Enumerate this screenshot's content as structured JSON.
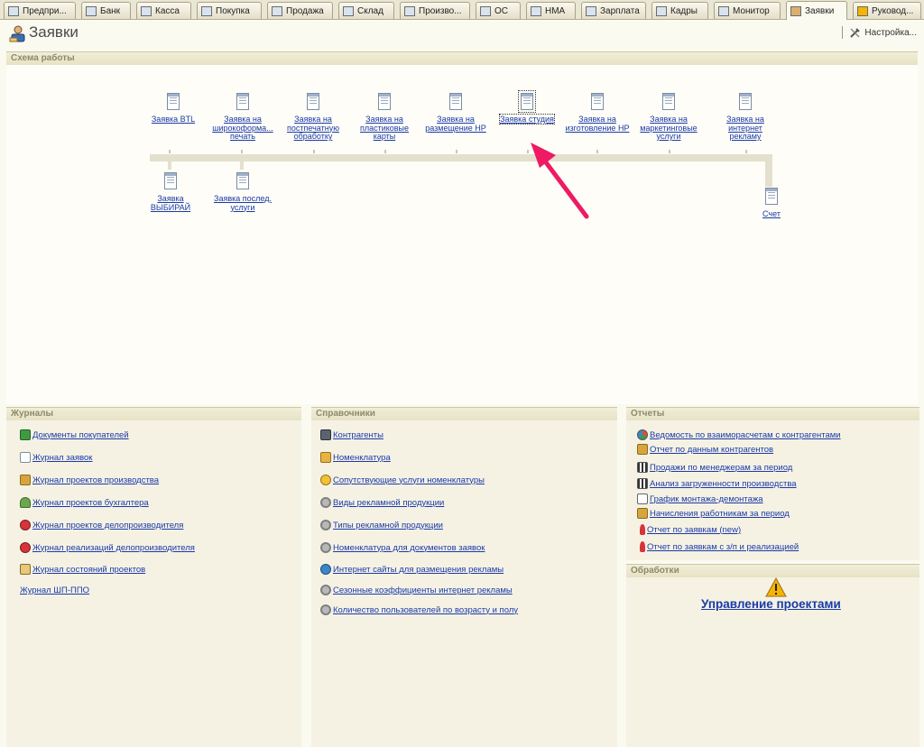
{
  "tabs": [
    {
      "label": "Предпри..."
    },
    {
      "label": "Банк"
    },
    {
      "label": "Касса"
    },
    {
      "label": "Покупка"
    },
    {
      "label": "Продажа"
    },
    {
      "label": "Склад"
    },
    {
      "label": "Произво..."
    },
    {
      "label": "ОС"
    },
    {
      "label": "НМА"
    },
    {
      "label": "Зарплата"
    },
    {
      "label": "Кадры"
    },
    {
      "label": "Монитор"
    },
    {
      "label": "Заявки",
      "active": true
    },
    {
      "label": "Руковод..."
    }
  ],
  "header": {
    "title": "Заявки",
    "settings_label": "Настройка..."
  },
  "scheme": {
    "title": "Схема работы",
    "top_row": [
      {
        "label": "Заявка BTL"
      },
      {
        "label": "Заявка на широкоформа... печать"
      },
      {
        "label": "Заявка на постпечатную обработку"
      },
      {
        "label": "Заявка на пластиковые карты"
      },
      {
        "label": "Заявка на размещение НР"
      },
      {
        "label": "Заявка студия",
        "selected": true
      },
      {
        "label": "Заявка на изготовление НР"
      },
      {
        "label": "Заявка на маркетинговые услуги"
      },
      {
        "label": "Заявка на интернет рекламу"
      }
    ],
    "bottom_row": [
      {
        "label": "Заявка ВЫБИРАЙ"
      },
      {
        "label": "Заявка послед. услуги"
      }
    ],
    "end_node": {
      "label": "Счет"
    }
  },
  "journals": {
    "title": "Журналы",
    "items": [
      {
        "label": "Документы покупателей",
        "icon": "green-book-icon"
      },
      {
        "label": "Журнал заявок",
        "icon": "document-icon"
      },
      {
        "label": "Журнал проектов производства",
        "icon": "folder-icon"
      },
      {
        "label": "Журнал проектов бухгалтера",
        "icon": "tree-icon"
      },
      {
        "label": "Журнал проектов делопроизводителя",
        "icon": "red-figure-icon"
      },
      {
        "label": "Журнал реализаций делопроизводителя",
        "icon": "red-figure-icon"
      },
      {
        "label": "Журнал состояний проектов",
        "icon": "status-icon"
      },
      {
        "label": "Журнал ШП-ППО",
        "icon": ""
      }
    ]
  },
  "references": {
    "title": "Справочники",
    "items": [
      {
        "label": "Контрагенты",
        "icon": "car-icon"
      },
      {
        "label": "Номенклатура",
        "icon": "box-icon"
      },
      {
        "label": "Сопутствующие услуги номенклатуры",
        "icon": "gold-icon"
      },
      {
        "label": "Виды рекламной продукции",
        "icon": "gear-icon"
      },
      {
        "label": "Типы  рекламной продукции",
        "icon": "gear-icon"
      },
      {
        "label": "Номенклатура для документов заявок",
        "icon": "gear-icon"
      },
      {
        "label": "Интернет сайты для размещения рекламы",
        "icon": "globe-icon"
      },
      {
        "label": "Сезонные коэффициенты интернет рекламы",
        "icon": "gear-icon"
      },
      {
        "label": "Количество пользователей по возрасту и полу",
        "icon": "gear-icon"
      }
    ]
  },
  "reports": {
    "title": "Отчеты",
    "items": [
      {
        "label": "Ведомость по взаиморасчетам с контрагентами",
        "icon": "pie-icon"
      },
      {
        "label": "Отчет по данным контрагентов",
        "icon": "folder-icon"
      },
      {
        "label": "Продажи по менеджерам за период",
        "icon": "bar-chart-icon"
      },
      {
        "label": "Анализ загруженности производства",
        "icon": "bar-chart-icon"
      },
      {
        "label": "График монтажа-демонтажа",
        "icon": "graph-icon"
      },
      {
        "label": "Начисления работникам за период",
        "icon": "folder-icon"
      },
      {
        "label": "Отчет по заявкам (new)",
        "icon": "warning-icon"
      },
      {
        "label": "Отчет по заявкам с з/п и реализацией",
        "icon": "warning-icon"
      }
    ]
  },
  "processing": {
    "title": "Обработки",
    "main_link": "Управление проектами"
  }
}
